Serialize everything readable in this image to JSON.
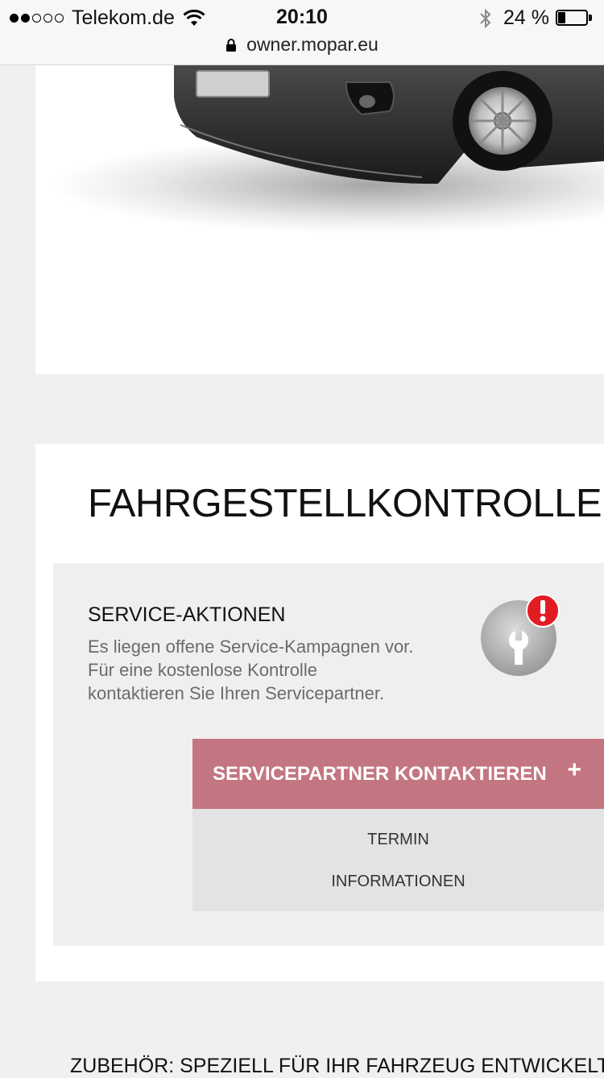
{
  "status_bar": {
    "carrier": "Telekom.de",
    "time": "20:10",
    "battery": "24 %",
    "battery_level": 0.24,
    "signal_bars": 2,
    "icons": [
      "wifi-icon",
      "bluetooth-icon",
      "battery-icon",
      "lock-icon"
    ]
  },
  "url_bar": {
    "url": "owner.mopar.eu"
  },
  "chassis": {
    "title": "FAHRGESTELLKONTROLLE",
    "service": {
      "heading": "SERVICE-AKTIONEN",
      "text_lines": [
        "Es liegen offene Service-Kampagnen vor.",
        "Für eine kostenlose Kontrolle",
        "kontaktieren Sie Ihren Servicepartner."
      ],
      "icon": "wrench-alert-icon",
      "alert_color": "#e31c23",
      "cta": {
        "label": "SERVICEPARTNER KONTAKTIEREN",
        "icon": "plus-icon",
        "color": "#c37681"
      },
      "options": [
        "TERMIN",
        "INFORMATIONEN"
      ]
    }
  },
  "next_section": {
    "title": "ZUBEHÖR: SPEZIELL FÜR IHR FAHRZEUG ENTWICKELT"
  }
}
